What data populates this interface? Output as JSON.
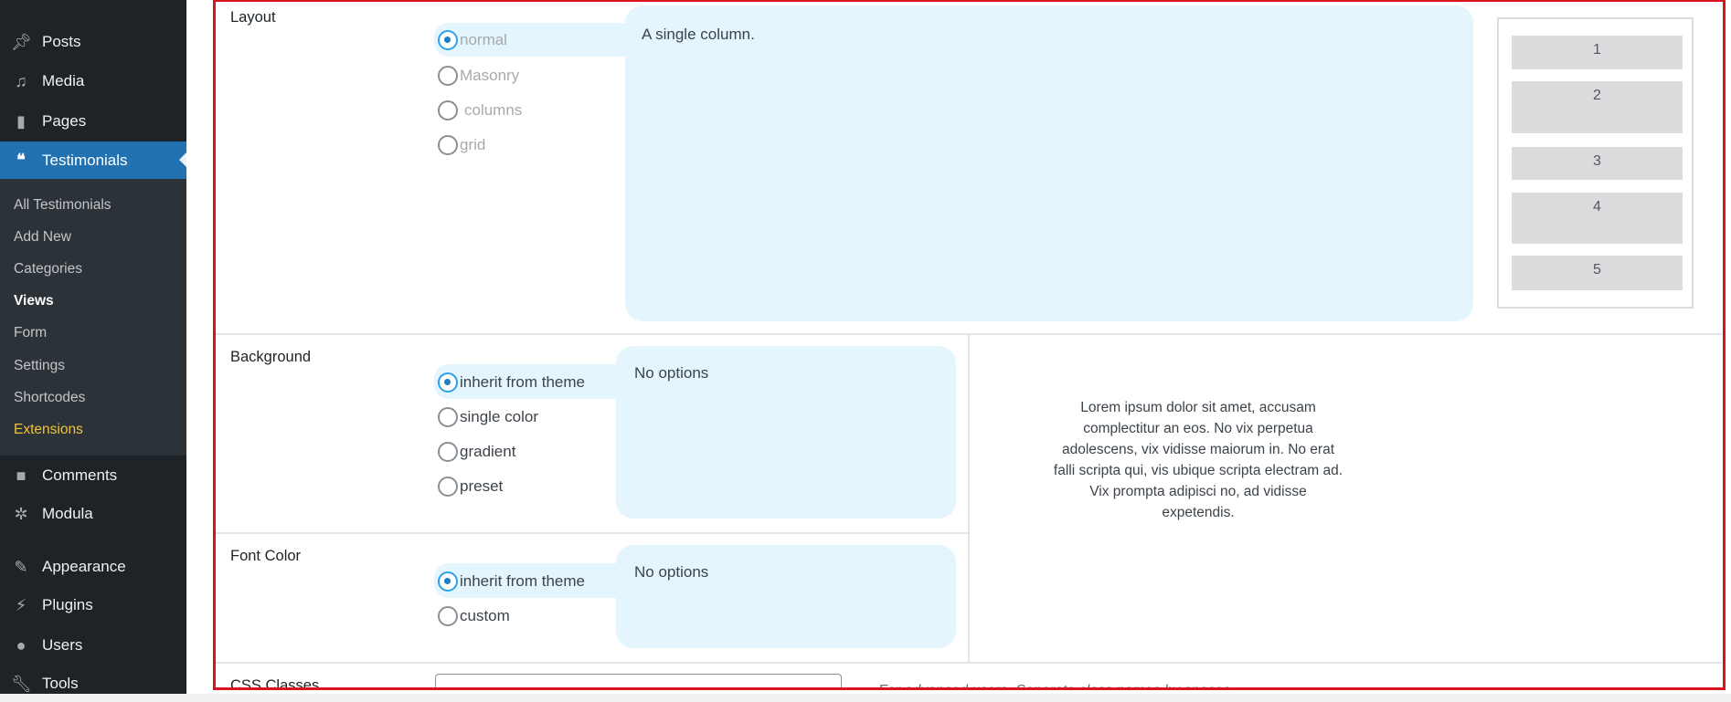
{
  "sidebar": {
    "top_items": [
      {
        "label": "Posts",
        "icon": "pin-icon"
      },
      {
        "label": "Media",
        "icon": "media-icon"
      },
      {
        "label": "Pages",
        "icon": "pages-icon"
      }
    ],
    "active": {
      "label": "Testimonials",
      "icon": "quote-icon"
    },
    "submenu": [
      "All Testimonials",
      "Add New",
      "Categories",
      "Views",
      "Form",
      "Settings",
      "Shortcodes",
      "Extensions"
    ],
    "current_sub": "Views",
    "bottom_items": [
      {
        "label": "Comments",
        "icon": "comment-icon"
      },
      {
        "label": "Modula",
        "icon": "gear-icon"
      },
      {
        "label": "Appearance",
        "icon": "brush-icon"
      },
      {
        "label": "Plugins",
        "icon": "plug-icon"
      },
      {
        "label": "Users",
        "icon": "user-icon"
      },
      {
        "label": "Tools",
        "icon": "wrench-icon"
      }
    ]
  },
  "layout": {
    "label": "Layout",
    "options": [
      "normal",
      "Masonry",
      "columns",
      "grid"
    ],
    "selected": "normal",
    "description": "A single column.",
    "preview_items": [
      "1",
      "2",
      "3",
      "4",
      "5"
    ]
  },
  "background": {
    "label": "Background",
    "options": [
      "inherit from theme",
      "single color",
      "gradient",
      "preset"
    ],
    "selected": "inherit from theme",
    "description": "No options"
  },
  "font_color": {
    "label": "Font Color",
    "options": [
      "inherit from theme",
      "custom"
    ],
    "selected": "inherit from theme",
    "description": "No options"
  },
  "preview_text": "Lorem ipsum dolor sit amet, accusam complectitur an eos. No vix perpetua adolescens, vix vidisse maiorum in. No erat falli scripta qui, vis ubique scripta electram ad. Vix prompta adipisci no, ad vidisse expetendis.",
  "css_classes": {
    "label": "CSS Classes",
    "value": "",
    "hint": "For advanced users. Separate class names by spaces."
  },
  "colors": {
    "highlight": "#2271b1",
    "option_bg": "#e5f5fd",
    "frame": "#d9141c",
    "extensions": "#f0c33c"
  }
}
